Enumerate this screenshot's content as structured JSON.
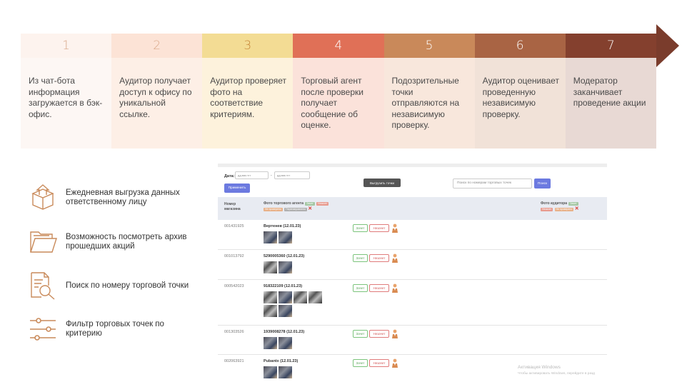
{
  "steps": [
    {
      "number": "1",
      "text": "Из чат-бота информация загружается в бэк-офис.",
      "header_color": "#fdf3ee",
      "body_color": "#fdf7f4",
      "number_color": "#d9a88a"
    },
    {
      "number": "2",
      "text": "Аудитор получает доступ к офису по уникальной ссылке.",
      "header_color": "#fce3d6",
      "body_color": "#fdefe6",
      "number_color": "#d9a88a"
    },
    {
      "number": "3",
      "text": "Аудитор проверяет фото на соответствие критериям.",
      "header_color": "#f3dc94",
      "body_color": "#fdf2dc",
      "number_color": "#c7873a"
    },
    {
      "number": "4",
      "text": "Торговый агент после проверки получает сообщение об оценке.",
      "header_color": "#e07057",
      "body_color": "#fbe2da",
      "number_color": "#ffffff"
    },
    {
      "number": "5",
      "text": "Подозрительные точки отправляются на независимую проверку.",
      "header_color": "#c9895a",
      "body_color": "#f8e7dc",
      "number_color": "#ffffff"
    },
    {
      "number": "6",
      "text": "Аудитор оценивает проведенную независимую проверку.",
      "header_color": "#a96444",
      "body_color": "#f1e2d8",
      "number_color": "#ffffff"
    },
    {
      "number": "7",
      "text": "Модератор заканчивает проведение акции",
      "header_color": "#84402e",
      "body_color": "#e8d9d4",
      "number_color": "#ffffff"
    }
  ],
  "features": [
    {
      "icon": "box-upload-icon",
      "text": "Ежедневная выгрузка данных ответственному лицу"
    },
    {
      "icon": "folder-icon",
      "text": "Возможность посмотреть архив прошедших акций"
    },
    {
      "icon": "document-search-icon",
      "text": "Поиск по номеру торговой точки"
    },
    {
      "icon": "filter-sliders-icon",
      "text": "Фильтр торговых точек по критерию"
    }
  ],
  "screenshot": {
    "date_label": "Дата:",
    "date_from_placeholder": "дд.мм.гггг",
    "date_to_placeholder": "дд.мм.гггг",
    "dash": "-",
    "apply_label": "Применить",
    "export_label": "Выгрузить точки",
    "search_placeholder": "Поиск по номерам торговых точек",
    "search_label": "Поиск",
    "col_number": "Номер магазина",
    "col_agent_photo": "Фото торгового агента",
    "col_auditor_photo": "Фото аудитора",
    "tag_accepted": "Зачет",
    "tag_rejected": "Незачет",
    "tag_not_checked": "Не проверено",
    "tag_redirected": "Перенаправлено",
    "ok_label": "Зачет",
    "no_label": "Незачет",
    "rows": [
      {
        "id": "001431925",
        "name": "Вертенев (12.01.23)"
      },
      {
        "id": "001013792",
        "name": "5290005360 (12.01.23)"
      },
      {
        "id": "000542023",
        "name": "918322109 (12.01.23)"
      },
      {
        "id": "001303526",
        "name": "1939008278 (12.01.23)"
      },
      {
        "id": "002063921",
        "name": "Pubantx (12.01.23)"
      }
    ],
    "watermark_title": "Активация Windows",
    "watermark_sub": "Чтобы активировать Windows, перейдите в разд"
  },
  "colors": {
    "accent": "#6c7ae0",
    "arrow": "#7a3c2c",
    "icon_stroke": "#c98a5a"
  }
}
